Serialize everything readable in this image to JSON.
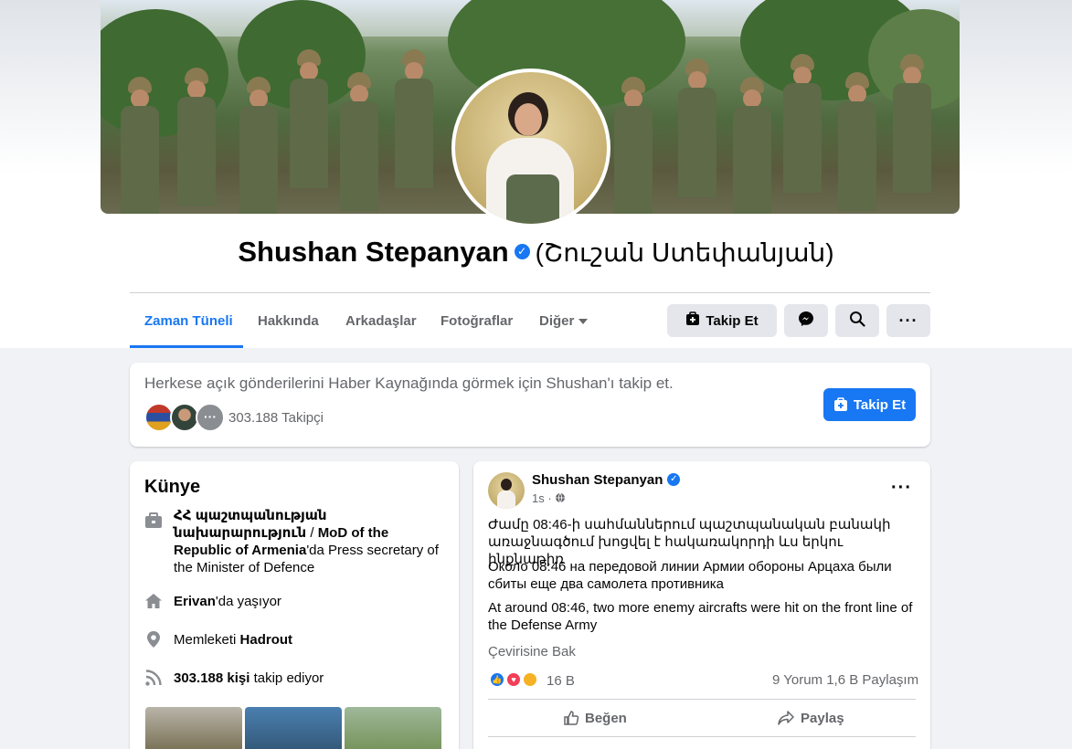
{
  "profile": {
    "name": "Shushan Stepanyan",
    "alt_name": "(Շուշան Ստեփանյան)",
    "verified": true
  },
  "tabs": [
    {
      "label": "Zaman Tüneli",
      "active": true
    },
    {
      "label": "Hakkında"
    },
    {
      "label": "Arkadaşlar"
    },
    {
      "label": "Fotoğraflar"
    },
    {
      "label": "Diğer"
    }
  ],
  "actions": {
    "follow_label": "Takip Et",
    "messenger_icon": "messenger-icon",
    "search_icon": "search-icon",
    "more_icon": "more-icon"
  },
  "follow_card": {
    "prompt": "Herkese açık gönderilerini Haber Kaynağında görmek için Shushan'ı takip et.",
    "follower_count": "303.188 Takipçi",
    "follow_label": "Takip Et"
  },
  "intro": {
    "title": "Künye",
    "work_bold": "ՀՀ պաշտպանության նախարարություն",
    "work_sep": " / ",
    "work_rest_bold": "MoD of the Republic of Armenia",
    "work_suffix": "'da Press secretary of the Minister of Defence",
    "lives_bold": "Erivan",
    "lives_suffix": "'da yaşıyor",
    "from_prefix": "Memleketi ",
    "from_bold": "Hadrout",
    "followers_bold": "303.188 kişi",
    "followers_suffix": " takip ediyor"
  },
  "post": {
    "author": "Shushan Stepanyan",
    "time": "1s ·",
    "text_hy": "Ժամը 08:46-ի սահմաններում պաշտպանական բանակի առաջնագծում խոցվել է հակառակորդի ևս երկու ինքնաթիռ",
    "text_ru": "Около 08:46 на передовой линии Армии обороны Арцаха были сбиты еще два самолета противника",
    "text_en": "At around 08:46, two more enemy aircrafts were hit on the front line of the Defense Army",
    "see_translation": "Çevirisine Bak",
    "reaction_count": "16 B",
    "comments": "9 Yorum",
    "shares": "1,6 B Paylaşım",
    "like_label": "Beğen",
    "share_label": "Paylaş"
  },
  "colors": {
    "accent": "#1877f2",
    "muted_text": "#65676b",
    "background": "#f0f2f5"
  }
}
